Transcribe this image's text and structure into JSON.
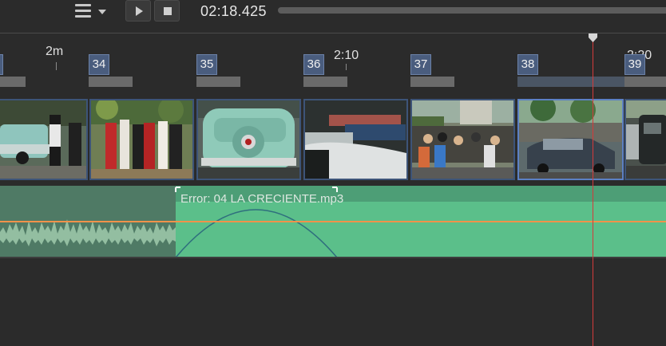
{
  "toolbar": {
    "menu_icon": "hamburger-menu-icon",
    "play_icon": "play-icon",
    "stop_icon": "stop-icon",
    "timecode": "02:18.425"
  },
  "ruler": {
    "labels": [
      "2m",
      "2:10",
      "2:20"
    ]
  },
  "scenes": [
    "34",
    "35",
    "36",
    "37",
    "38",
    "39"
  ],
  "audio": {
    "clip_label": "Error: 04 LA CRECIENTE.mp3"
  },
  "colors": {
    "accent_blue": "#4a5d7e",
    "audio_green": "#5bbf8a",
    "volume_line": "#f2924a",
    "playhead": "#d43a3a"
  }
}
